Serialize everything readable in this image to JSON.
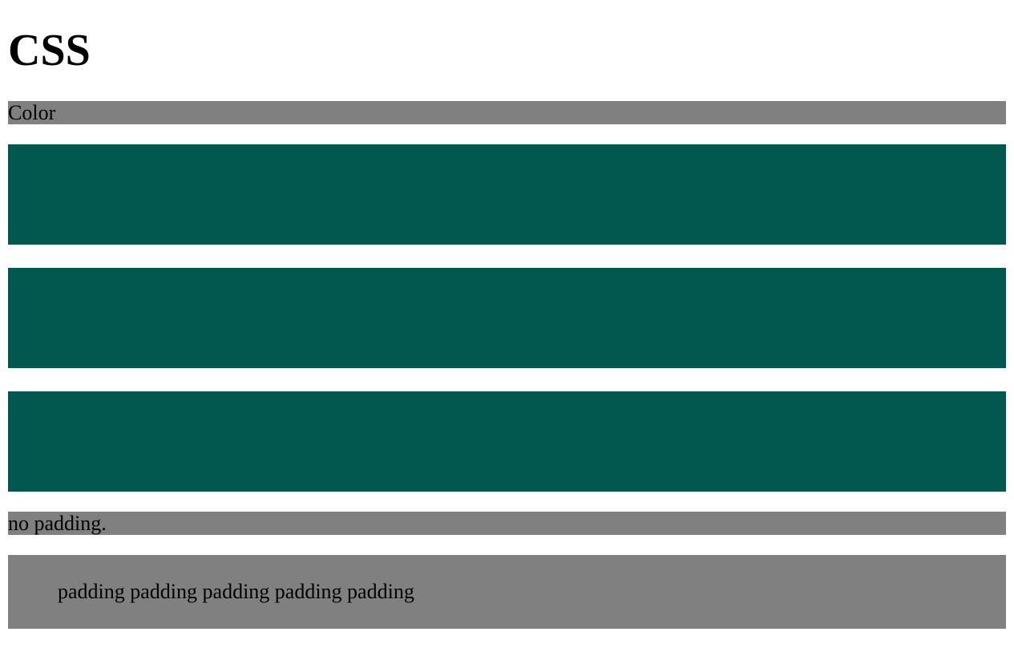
{
  "title": "CSS",
  "sections": {
    "color_label": "Color",
    "no_padding_label": "no padding.",
    "padding_label": "padding padding padding padding padding"
  },
  "colors": {
    "gray": "#808080",
    "teal": "#02574f"
  }
}
